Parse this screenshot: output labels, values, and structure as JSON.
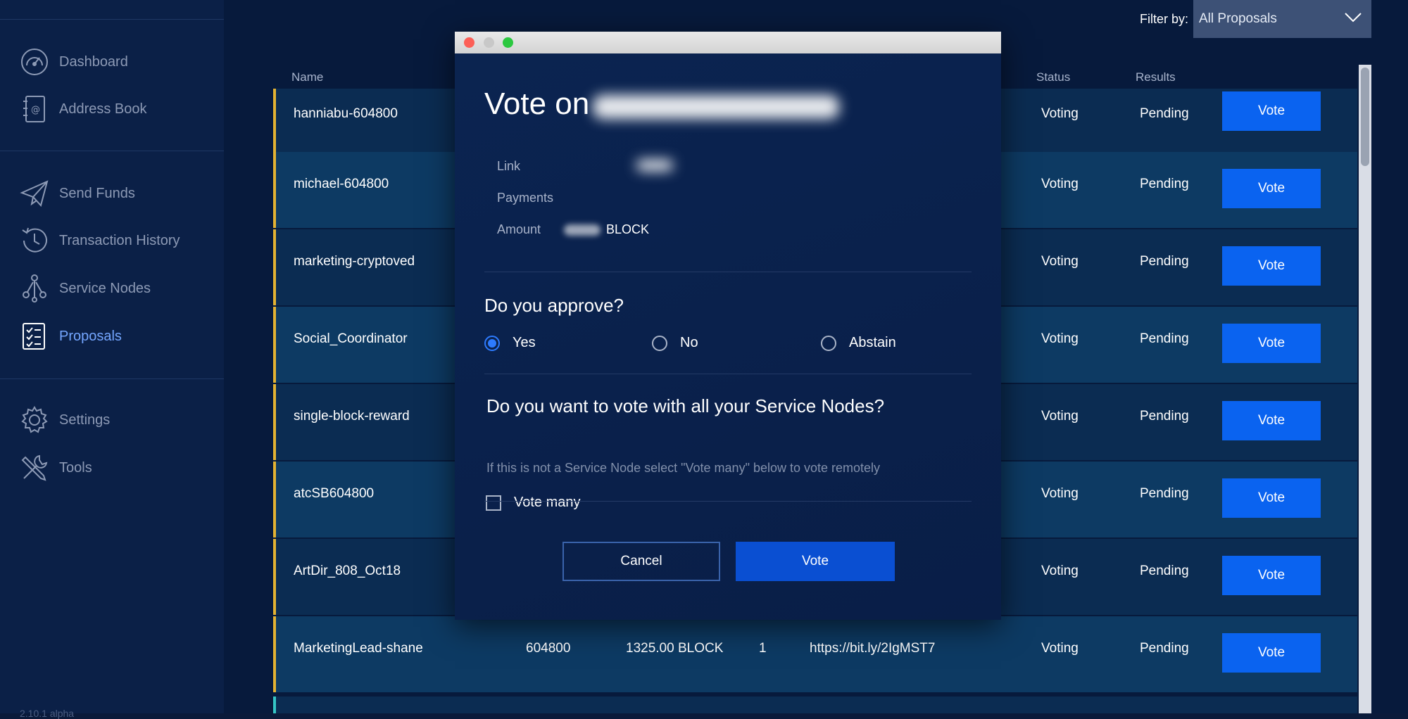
{
  "sidebar": {
    "items": [
      {
        "label": "Dashboard",
        "icon": "dashboard-gauge-icon"
      },
      {
        "label": "Address Book",
        "icon": "address-book-icon"
      },
      {
        "label": "Send Funds",
        "icon": "paper-plane-icon"
      },
      {
        "label": "Transaction History",
        "icon": "history-clock-icon"
      },
      {
        "label": "Service Nodes",
        "icon": "network-nodes-icon"
      },
      {
        "label": "Proposals",
        "icon": "checklist-icon",
        "active": true
      },
      {
        "label": "Settings",
        "icon": "gear-icon"
      },
      {
        "label": "Tools",
        "icon": "tools-icon"
      }
    ],
    "version": "2.10.1 alpha"
  },
  "filter": {
    "label": "Filter by:",
    "selected": "All Proposals"
  },
  "table": {
    "columns": {
      "name": "Name",
      "status": "Status",
      "results": "Results"
    },
    "vote_label": "Vote",
    "rows": [
      {
        "name": "hanniabu-604800",
        "status": "Voting",
        "result": "Pending"
      },
      {
        "name": "michael-604800",
        "status": "Voting",
        "result": "Pending"
      },
      {
        "name": "marketing-cryptoved",
        "status": "Voting",
        "result": "Pending"
      },
      {
        "name": "Social_Coordinator",
        "status": "Voting",
        "result": "Pending"
      },
      {
        "name": "single-block-reward",
        "status": "Voting",
        "result": "Pending"
      },
      {
        "name": "atcSB604800",
        "status": "Voting",
        "result": "Pending"
      },
      {
        "name": "ArtDir_808_Oct18",
        "status": "Voting",
        "result": "Pending"
      },
      {
        "name": "MarketingLead-shane",
        "block": "604800",
        "amount": "1325.00 BLOCK",
        "count": "1",
        "url": "https://bit.ly/2IgMST7",
        "status": "Voting",
        "result": "Pending"
      }
    ]
  },
  "modal": {
    "title_prefix": "Vote on",
    "labels": {
      "link": "Link",
      "payments": "Payments",
      "amount": "Amount"
    },
    "amount_unit": "BLOCK",
    "approve_heading": "Do you approve?",
    "options": {
      "yes": "Yes",
      "no": "No",
      "abstain": "Abstain"
    },
    "selected_option": "yes",
    "nodes_heading": "Do you want to vote with all your Service Nodes?",
    "nodes_hint": "If this is not a Service Node select \"Vote many\" below to vote remotely",
    "vote_many_label": "Vote many",
    "vote_many_checked": false,
    "cancel_label": "Cancel",
    "vote_label": "Vote"
  },
  "colors": {
    "accent": "#0a63f0",
    "row_marker": "#e3b232",
    "active_nav": "#74a6ff"
  }
}
